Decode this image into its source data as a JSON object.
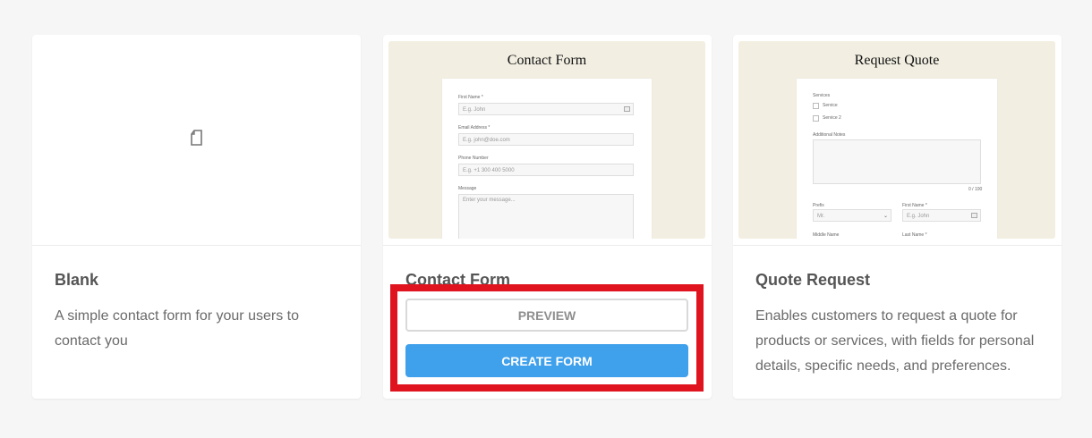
{
  "templates": [
    {
      "title": "Blank",
      "description": "A simple contact form for your users to contact you",
      "icon": "document-icon"
    },
    {
      "title": "Contact Form",
      "preview": {
        "heading": "Contact Form",
        "fields": [
          {
            "label": "First Name *",
            "placeholder": "E.g. John"
          },
          {
            "label": "Email Address *",
            "placeholder": "E.g. john@doe.com"
          },
          {
            "label": "Phone Number",
            "placeholder": "E.g. +1 300 400 5000"
          },
          {
            "label": "Message",
            "placeholder": "Enter your message..."
          }
        ]
      },
      "buttons": {
        "preview": "PREVIEW",
        "create": "CREATE FORM"
      }
    },
    {
      "title": "Quote Request",
      "description": "Enables customers to request a quote for products or services, with fields for personal details, specific needs, and preferences.",
      "preview": {
        "heading": "Request Quote",
        "services_label": "Services",
        "service_options": [
          "Service",
          "Service 2"
        ],
        "additional_label": "Additional Notes",
        "prefix_label": "Prefix",
        "prefix_value": "Mr.",
        "first_name_label": "First Name *",
        "first_name_placeholder": "E.g. John",
        "middle_name_label": "Middle Name",
        "last_name_label": "Last Name *",
        "char_count": "0 / 100"
      }
    }
  ],
  "colors": {
    "accent": "#3fa0eb",
    "highlight": "#e0141f",
    "thumb_bg": "#f2efe2",
    "page_bg": "#f6f6f6"
  }
}
